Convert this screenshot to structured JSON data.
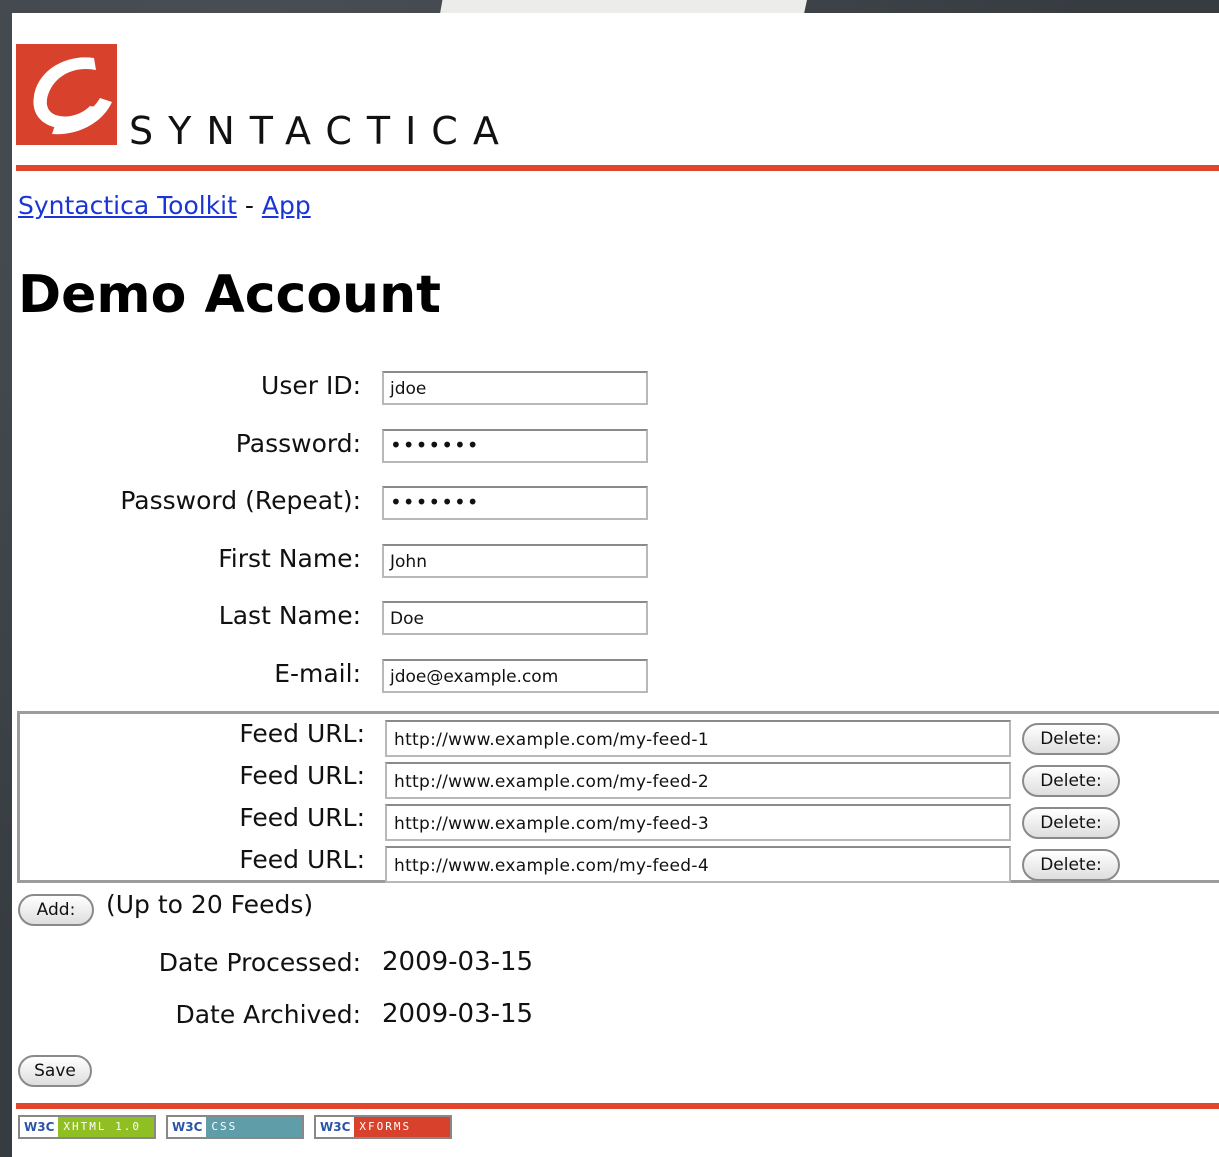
{
  "brand": {
    "name": "SYNTACTICA",
    "accent_color": "#e1452b"
  },
  "breadcrumb": {
    "link1": "Syntactica Toolkit",
    "separator": "-",
    "link2": "App"
  },
  "page_title": "Demo Account",
  "form": {
    "user_id": {
      "label": "User ID:",
      "value": "jdoe"
    },
    "password": {
      "label": "Password:",
      "value": "•••••••"
    },
    "password_repeat": {
      "label": "Password (Repeat):",
      "value": "•••••••"
    },
    "first_name": {
      "label": "First Name:",
      "value": "John"
    },
    "last_name": {
      "label": "Last Name:",
      "value": "Doe"
    },
    "email": {
      "label": "E-mail:",
      "value": "jdoe@example.com"
    }
  },
  "feeds": [
    {
      "label": "Feed URL:",
      "value": "http://www.example.com/my-feed-1",
      "delete_label": "Delete:"
    },
    {
      "label": "Feed URL:",
      "value": "http://www.example.com/my-feed-2",
      "delete_label": "Delete:"
    },
    {
      "label": "Feed URL:",
      "value": "http://www.example.com/my-feed-3",
      "delete_label": "Delete:"
    },
    {
      "label": "Feed URL:",
      "value": "http://www.example.com/my-feed-4",
      "delete_label": "Delete:"
    }
  ],
  "add": {
    "button_label": "Add:",
    "note": "(Up to 20 Feeds)"
  },
  "dates": {
    "processed": {
      "label": "Date Processed:",
      "value": "2009-03-15"
    },
    "archived": {
      "label": "Date Archived:",
      "value": "2009-03-15"
    }
  },
  "save_label": "Save",
  "badges": [
    {
      "w3c": "W3C",
      "tag": "XHTML 1.0",
      "color": "#8fbf22"
    },
    {
      "w3c": "W3C",
      "tag": "CSS",
      "color": "#5f9ea8"
    },
    {
      "w3c": "W3C",
      "tag": "XFORMS",
      "color": "#d8412c"
    }
  ]
}
